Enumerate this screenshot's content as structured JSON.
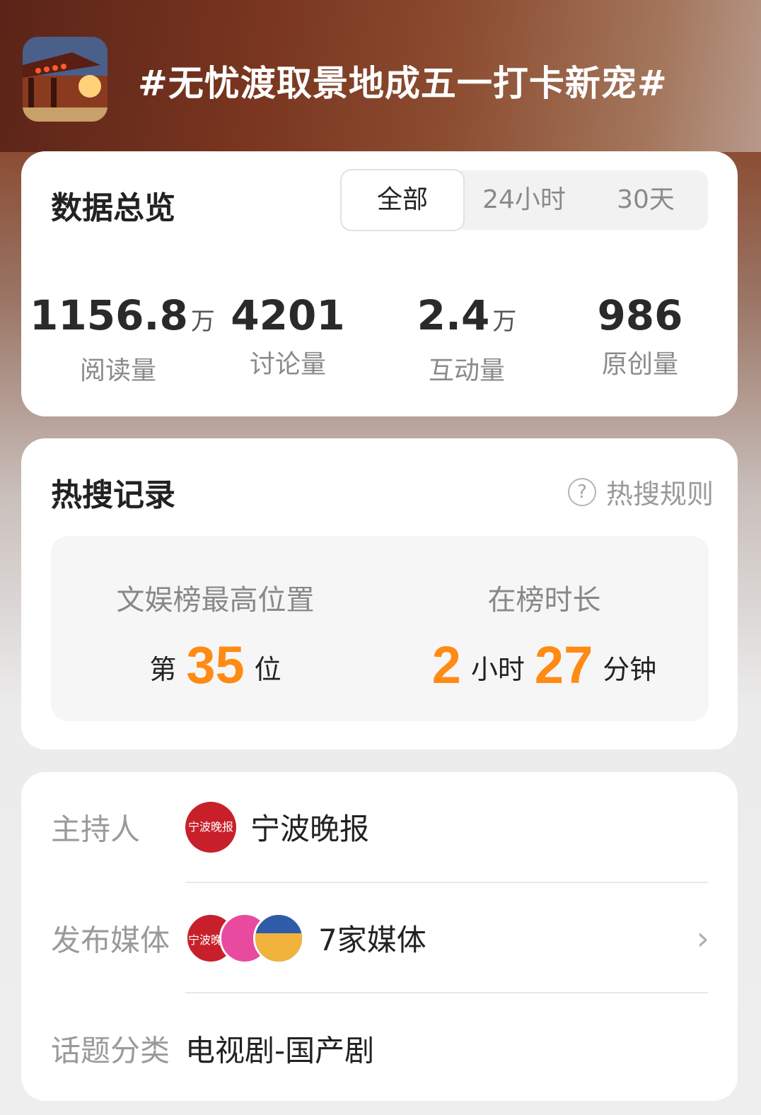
{
  "topic": {
    "title": "#无忧渡取景地成五一打卡新宠#",
    "cover_icon": "temple-cover-image"
  },
  "overview": {
    "title": "数据总览",
    "tabs": [
      {
        "label": "全部",
        "active": true
      },
      {
        "label": "24小时",
        "active": false
      },
      {
        "label": "30天",
        "active": false
      }
    ],
    "stats": [
      {
        "value": "1156.8",
        "unit": "万",
        "label": "阅读量"
      },
      {
        "value": "4201",
        "unit": "",
        "label": "讨论量"
      },
      {
        "value": "2.4",
        "unit": "万",
        "label": "互动量"
      },
      {
        "value": "986",
        "unit": "",
        "label": "原创量"
      }
    ]
  },
  "hot_search": {
    "title": "热搜记录",
    "rules_label": "热搜规则",
    "rules_icon": "question-circle-icon",
    "rank": {
      "label": "文娱榜最高位置",
      "prefix": "第",
      "value": "35",
      "suffix": "位"
    },
    "duration": {
      "label": "在榜时长",
      "hours": "2",
      "hours_unit": "小时",
      "minutes": "27",
      "minutes_unit": "分钟"
    },
    "accent_color": "#ff8a14"
  },
  "info": {
    "host": {
      "label": "主持人",
      "name": "宁波晚报",
      "avatar_text": "宁波晚报"
    },
    "publishers": {
      "label": "发布媒体",
      "summary": "7家媒体",
      "chevron_icon": "chevron-right-icon"
    },
    "category": {
      "label": "话题分类",
      "value": "电视剧-国产剧"
    }
  }
}
